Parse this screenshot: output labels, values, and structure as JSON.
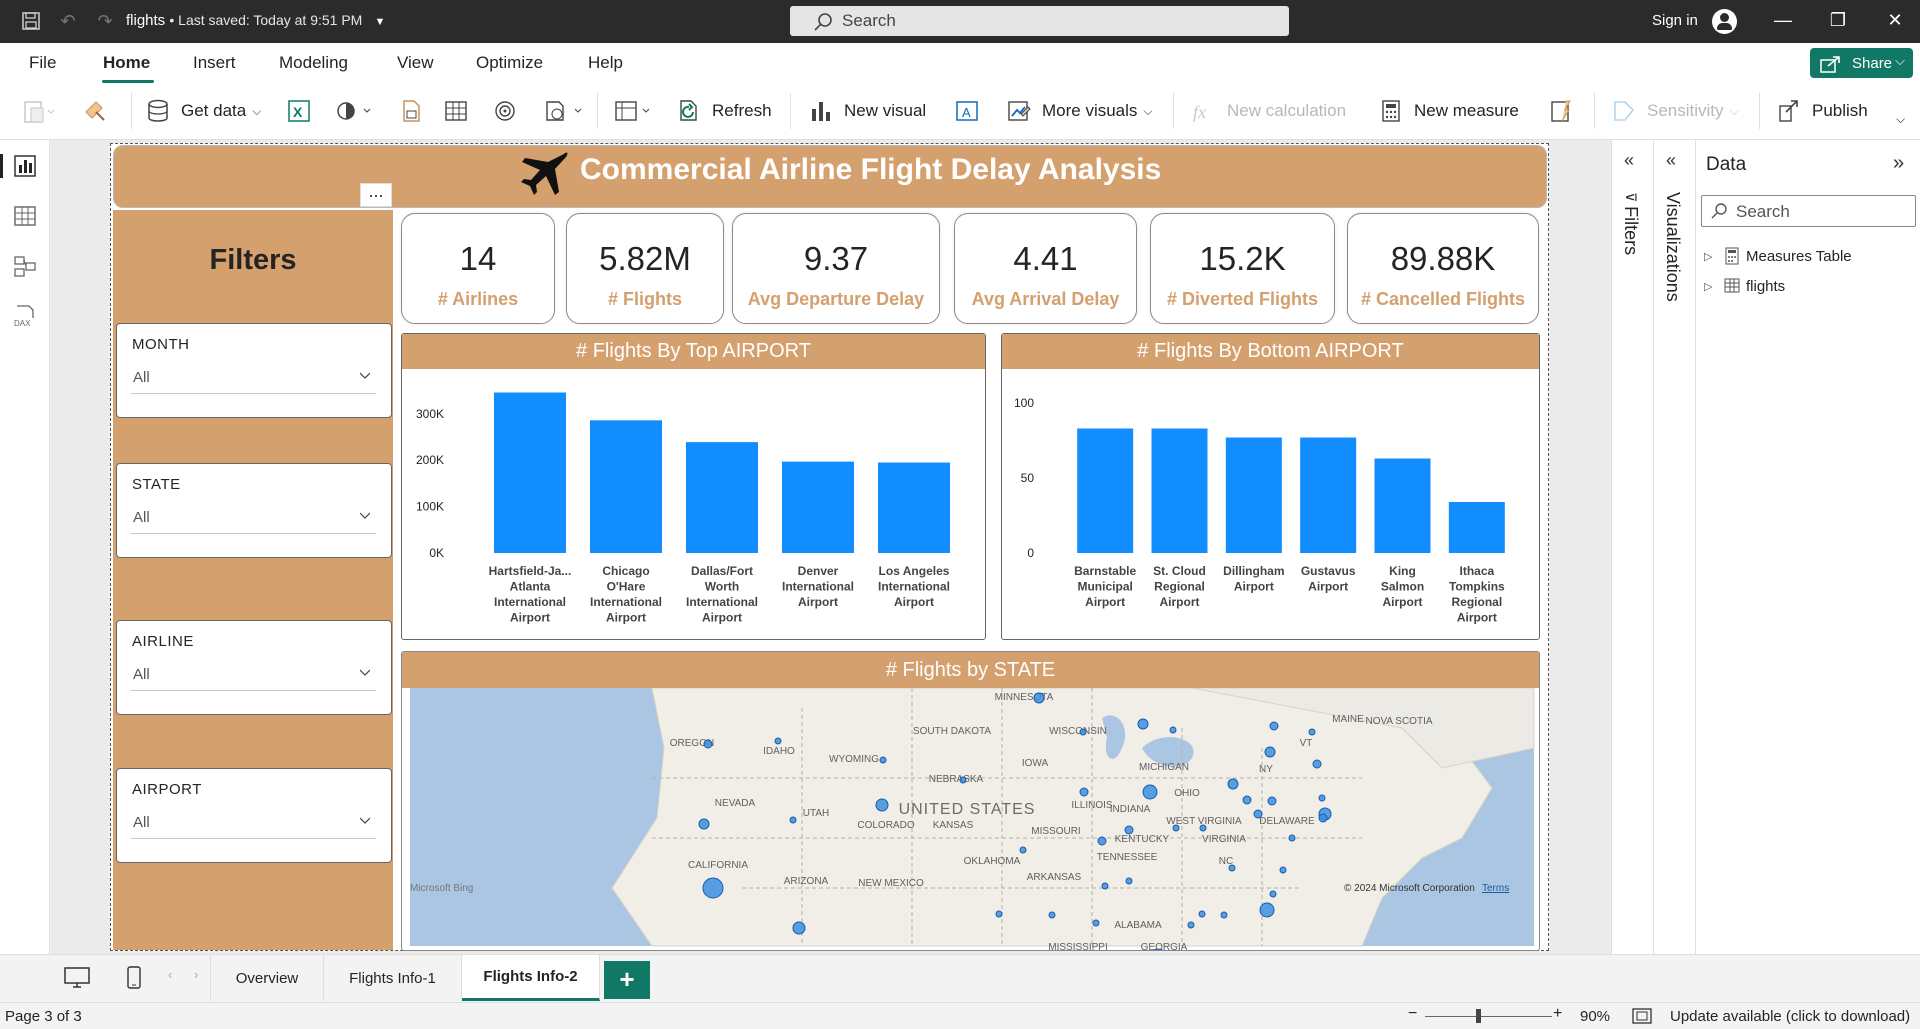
{
  "titlebar": {
    "file_name": "flights",
    "saved_text": "Last saved: Today at 9:51 PM",
    "search_placeholder": "Search",
    "signin": "Sign in"
  },
  "menu": {
    "items": [
      "File",
      "Home",
      "Insert",
      "Modeling",
      "View",
      "Optimize",
      "Help"
    ],
    "active": "Home",
    "share": "Share"
  },
  "ribbon": {
    "get_data": "Get data",
    "refresh": "Refresh",
    "new_visual": "New visual",
    "more_visuals": "More visuals",
    "new_calculation": "New calculation",
    "new_measure": "New measure",
    "sensitivity": "Sensitivity",
    "publish": "Publish"
  },
  "report": {
    "title": "Commercial Airline Flight Delay Analysis",
    "more_options": "...",
    "filters_title": "Filters",
    "slicers": [
      {
        "label": "MONTH",
        "value": "All"
      },
      {
        "label": "STATE",
        "value": "All"
      },
      {
        "label": "AIRLINE",
        "value": "All"
      },
      {
        "label": "AIRPORT",
        "value": "All"
      }
    ],
    "kpis": [
      {
        "value": "14",
        "label": "# Airlines"
      },
      {
        "value": "5.82M",
        "label": "# Flights"
      },
      {
        "value": "9.37",
        "label": "Avg Departure Delay"
      },
      {
        "value": "4.41",
        "label": "Avg Arrival Delay"
      },
      {
        "value": "15.2K",
        "label": "# Diverted Flights"
      },
      {
        "value": "89.88K",
        "label": "# Cancelled Flights"
      }
    ],
    "map": {
      "title": "# Flights by STATE",
      "country_label": "UNITED STATES",
      "attribution": "© 2024 Microsoft Corporation",
      "terms": "Terms",
      "logo": "Microsoft Bing",
      "labels": [
        "MINNESOTA",
        "SOUTH DAKOTA",
        "WISCONSIN",
        "MICHIGAN",
        "OREGON",
        "IDAHO",
        "WYOMING",
        "NEBRASKA",
        "IOWA",
        "NEVADA",
        "UTAH",
        "COLORADO",
        "KANSAS",
        "MISSOURI",
        "ILLINOIS",
        "INDIANA",
        "OHIO",
        "CALIFORNIA",
        "ARIZONA",
        "NEW MEXICO",
        "OKLAHOMA",
        "ARKANSAS",
        "TENNESSEE",
        "KENTUCKY",
        "WEST VIRGINIA",
        "VIRGINIA",
        "NC",
        "NY",
        "VT",
        "MAINE",
        "NOVA SCOTIA",
        "DELAWARE",
        "ALABAMA",
        "GEORGIA",
        "MISSISSIPPI"
      ]
    }
  },
  "chart_data": [
    {
      "type": "bar",
      "title": "# Flights By Top AIRPORT",
      "categories": [
        "Hartsfield-Ja... Atlanta International Airport",
        "Chicago O'Hare International Airport",
        "Dallas/Fort Worth International Airport",
        "Denver International Airport",
        "Los Angeles International Airport"
      ],
      "category_lines": [
        [
          "Hartsfield-Ja...",
          "Atlanta",
          "International",
          "Airport"
        ],
        [
          "Chicago",
          "O'Hare",
          "International",
          "Airport"
        ],
        [
          "Dallas/Fort",
          "Worth",
          "International",
          "Airport"
        ],
        [
          "Denver",
          "International",
          "Airport"
        ],
        [
          "Los Angeles",
          "International",
          "Airport"
        ]
      ],
      "values": [
        346000,
        286000,
        239000,
        197000,
        195000
      ],
      "yticks": [
        "0K",
        "100K",
        "200K",
        "300K"
      ],
      "ylim": [
        0,
        360000
      ],
      "color": "#118dff"
    },
    {
      "type": "bar",
      "title": "# Flights By Bottom AIRPORT",
      "categories": [
        "Barnstable Municipal Airport",
        "St. Cloud Regional Airport",
        "Dillingham Airport",
        "Gustavus Airport",
        "King Salmon Airport",
        "Ithaca Tompkins Regional Airport"
      ],
      "category_lines": [
        [
          "Barnstable",
          "Municipal",
          "Airport"
        ],
        [
          "St. Cloud",
          "Regional",
          "Airport"
        ],
        [
          "Dillingham",
          "Airport"
        ],
        [
          "Gustavus",
          "Airport"
        ],
        [
          "King",
          "Salmon",
          "Airport"
        ],
        [
          "Ithaca",
          "Tompkins",
          "Regional",
          "Airport"
        ]
      ],
      "values": [
        83,
        83,
        77,
        77,
        63,
        34
      ],
      "yticks": [
        "0",
        "50",
        "100"
      ],
      "ylim": [
        0,
        100
      ],
      "color": "#118dff"
    }
  ],
  "panes": {
    "filters": "Filters",
    "visualizations": "Visualizations",
    "data": {
      "title": "Data",
      "search_placeholder": "Search",
      "tables": [
        "Measures Table",
        "flights"
      ]
    }
  },
  "pages": {
    "tabs": [
      "Overview",
      "Flights Info-1",
      "Flights Info-2"
    ],
    "active": "Flights Info-2",
    "add": "+"
  },
  "status": {
    "page": "Page 3 of 3",
    "zoom": "90%",
    "update": "Update available (click to download)"
  }
}
